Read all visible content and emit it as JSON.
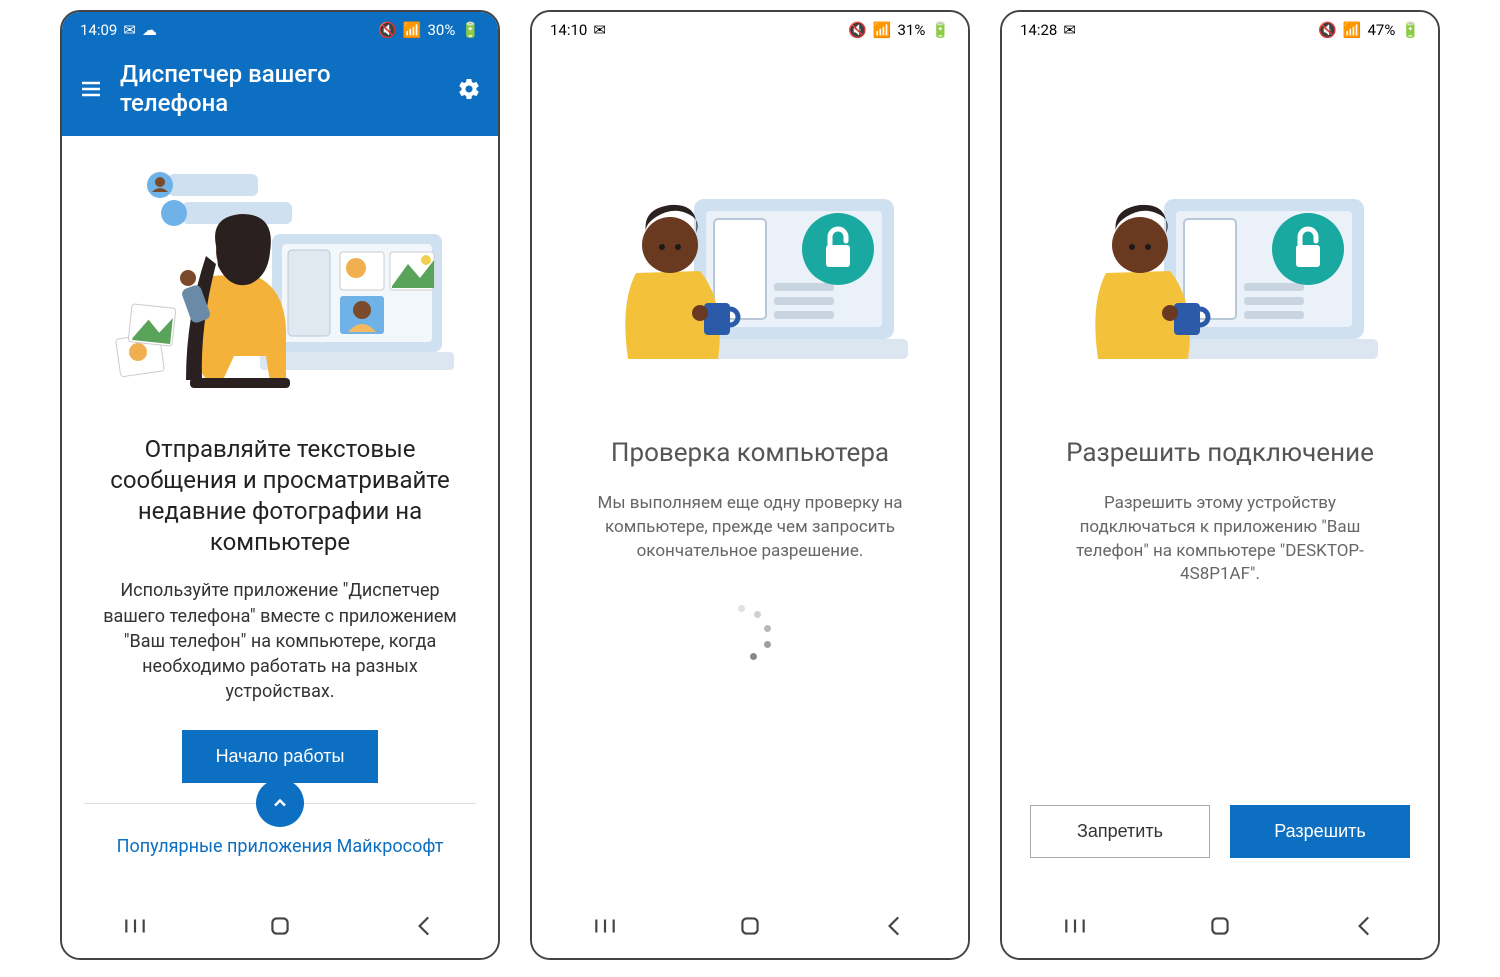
{
  "screens": [
    {
      "status": {
        "time": "14:09",
        "battery": "30%"
      },
      "header": {
        "title": "Диспетчер вашего телефона"
      },
      "headline": "Отправляйте текстовые сообщения и просматривайте недавние фотографии на компьютере",
      "body": "Используйте приложение \"Диспетчер вашего телефона\" вместе с приложением \"Ваш телефон\" на компьютере, когда необходимо работать на разных устройствах.",
      "primary_button": "Начало работы",
      "footer_link": "Популярные приложения Майкрософт"
    },
    {
      "status": {
        "time": "14:10",
        "battery": "31%"
      },
      "headline": "Проверка компьютера",
      "body": "Мы выполняем еще одну проверку на компьютере, прежде чем запросить окончательное разрешение."
    },
    {
      "status": {
        "time": "14:28",
        "battery": "47%"
      },
      "headline": "Разрешить подключение",
      "body": "Разрешить этому устройству подключаться к приложению \"Ваш телефон\" на компьютере \"DESKTOP-4S8P1AF\".",
      "deny_button": "Запретить",
      "allow_button": "Разрешить"
    }
  ],
  "icons": {
    "mute": "🔇",
    "wifi": "📶",
    "batt": "🔋"
  }
}
